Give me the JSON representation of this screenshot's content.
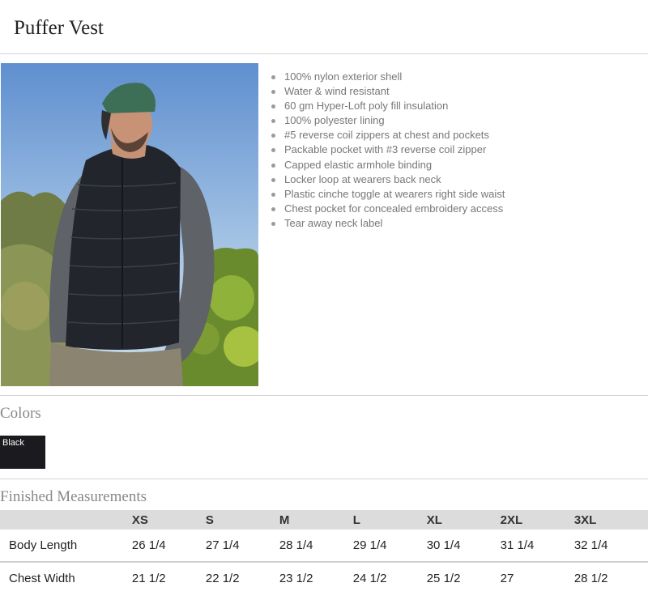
{
  "product": {
    "title": "Puffer Vest"
  },
  "features": [
    "100% nylon exterior shell",
    "Water & wind resistant",
    "60 gm Hyper-Loft poly fill insulation",
    "100% polyester lining",
    "#5 reverse coil zippers at chest and pockets",
    "Packable pocket with #3 reverse coil zipper",
    "Capped elastic armhole binding",
    "Locker loop at wearers back neck",
    "Plastic cinche toggle at wearers right side waist",
    "Chest pocket for concealed embroidery access",
    "Tear away neck label"
  ],
  "colors": {
    "heading": "Colors",
    "swatches": [
      {
        "name": "Black",
        "hex": "#1b1b1f"
      }
    ]
  },
  "measurements": {
    "heading": "Finished Measurements",
    "sizes": [
      "XS",
      "S",
      "M",
      "L",
      "XL",
      "2XL",
      "3XL"
    ],
    "rows": [
      {
        "label": "Body Length",
        "values": [
          "26 1/4",
          "27 1/4",
          "28 1/4",
          "29 1/4",
          "30 1/4",
          "31 1/4",
          "32 1/4"
        ]
      },
      {
        "label": "Chest Width",
        "values": [
          "21 1/2",
          "22 1/2",
          "23 1/2",
          "24 1/2",
          "25 1/2",
          "27",
          "28 1/2"
        ]
      }
    ]
  }
}
